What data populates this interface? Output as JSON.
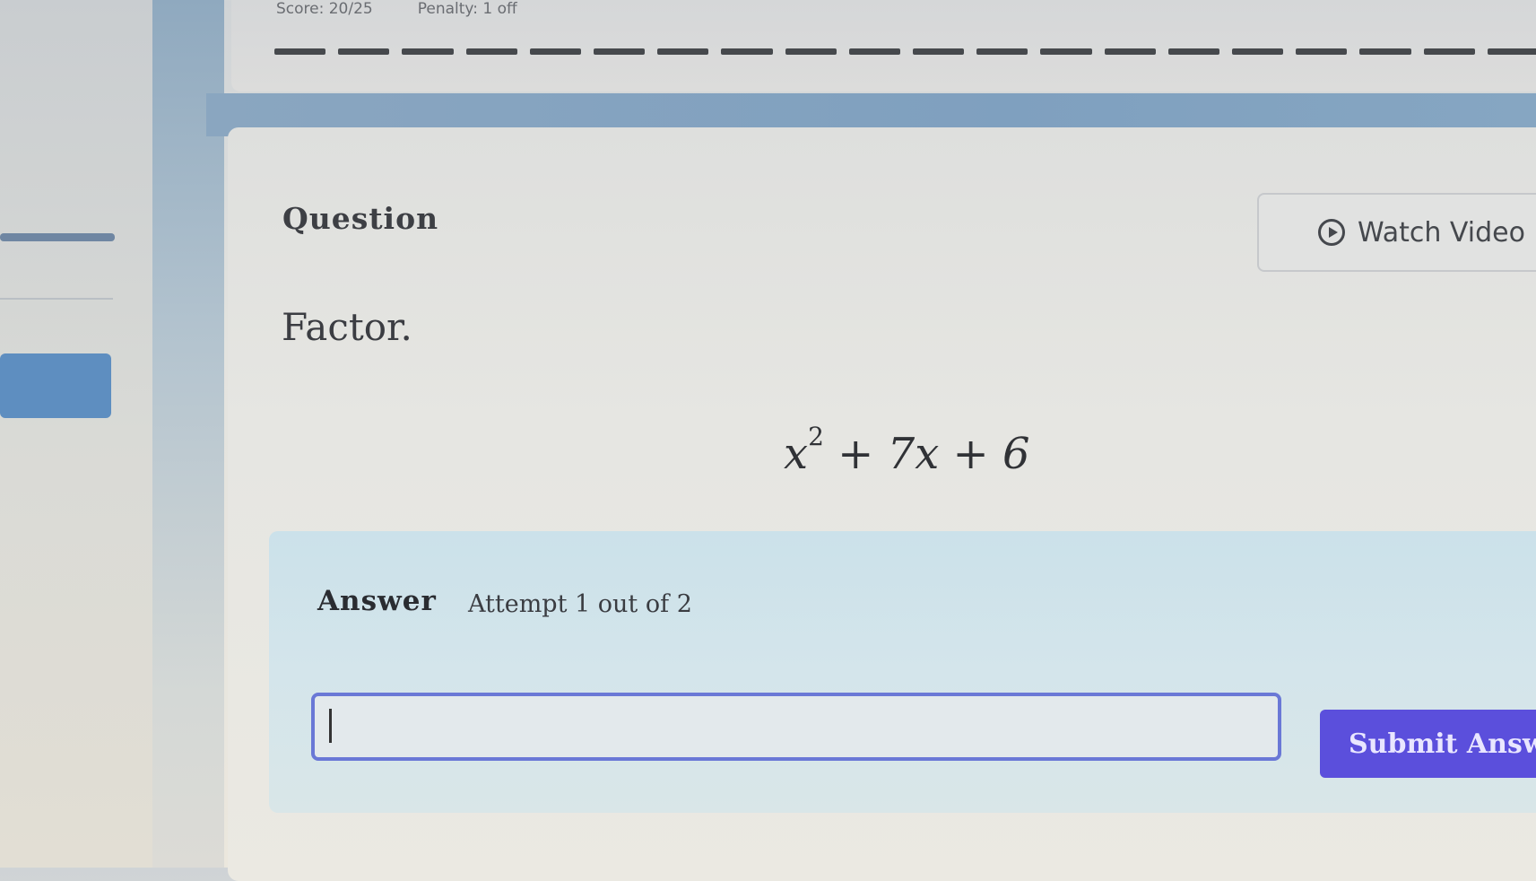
{
  "top_bar": {
    "score": "Score: 20/25",
    "penalty": "Penalty: 1 off"
  },
  "question": {
    "heading": "Question",
    "watch_video_label": "Watch Video",
    "prompt": "Factor.",
    "expression": {
      "base": "x",
      "exponent": "2",
      "rest": "+ 7x + 6"
    }
  },
  "answer": {
    "heading": "Answer",
    "attempt_text": "Attempt 1 out of 2",
    "input_value": "",
    "submit_label": "Submit Answer"
  },
  "colors": {
    "accent_button": "#5b4fdc",
    "input_border": "#6a78d6",
    "answer_panel_bg": "#d4e5eb"
  },
  "icons": {
    "watch_video": "play-circle-icon"
  }
}
